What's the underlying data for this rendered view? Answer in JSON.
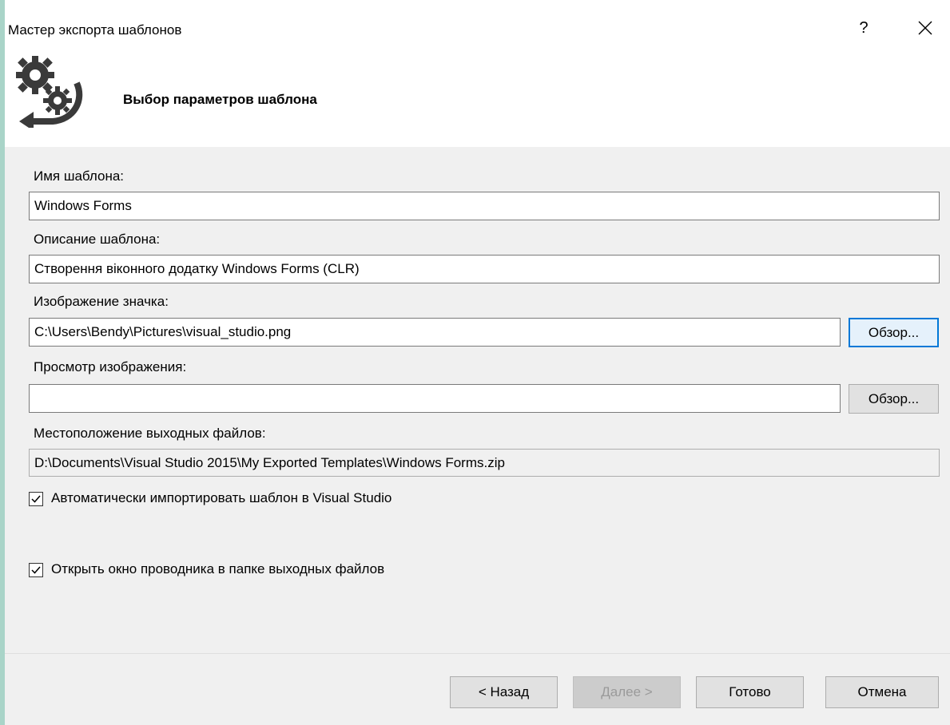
{
  "window": {
    "title": "Мастер экспорта шаблонов",
    "help_label": "?"
  },
  "header": {
    "title": "Выбор параметров шаблона",
    "icon": "gears-arrow-icon"
  },
  "form": {
    "template_name": {
      "label": "Имя шаблона:",
      "value": "Windows Forms"
    },
    "template_description": {
      "label": "Описание шаблона:",
      "value": "Створення віконного додатку Windows Forms (CLR)"
    },
    "icon_image": {
      "label": "Изображение значка:",
      "value": "C:\\Users\\Bendy\\Pictures\\visual_studio.png",
      "browse_label": "Обзор..."
    },
    "preview_image": {
      "label": "Просмотр изображения:",
      "value": "",
      "browse_label": "Обзор..."
    },
    "output_location": {
      "label": "Местоположение выходных файлов:",
      "value": "D:\\Documents\\Visual Studio 2015\\My Exported Templates\\Windows Forms.zip"
    },
    "auto_import": {
      "label": "Автоматически импортировать шаблон в Visual Studio",
      "checked": true
    },
    "open_explorer": {
      "label": "Открыть окно проводника в папке выходных файлов",
      "checked": true
    }
  },
  "footer": {
    "back_label": "< Назад",
    "next_label": "Далее >",
    "finish_label": "Готово",
    "cancel_label": "Отмена"
  },
  "colors": {
    "accent": "#0078d7",
    "dialog_background": "#f0f0f0",
    "header_background": "#ffffff"
  }
}
